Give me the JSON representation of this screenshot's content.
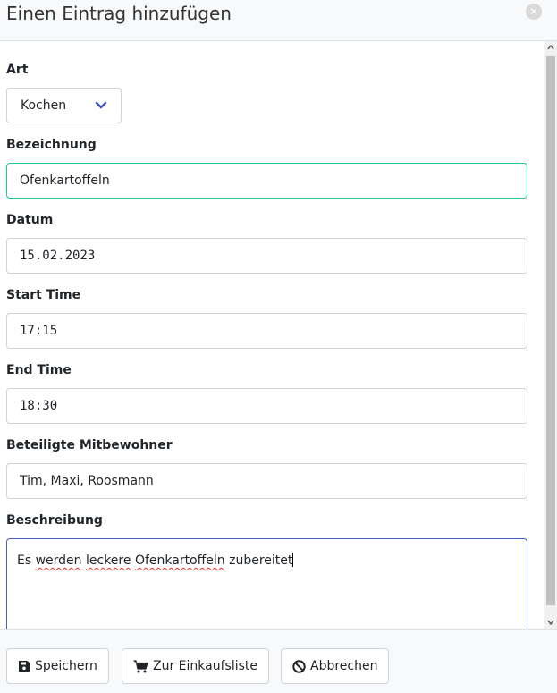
{
  "dialog": {
    "title": "Einen Eintrag hinzufügen",
    "close_icon": "close-icon"
  },
  "form": {
    "art": {
      "label": "Art",
      "selected": "Kochen"
    },
    "bezeichnung": {
      "label": "Bezeichnung",
      "value": "Ofenkartoffeln"
    },
    "datum": {
      "label": "Datum",
      "value": "15.02.2023"
    },
    "start_time": {
      "label": "Start Time",
      "value": "17:15"
    },
    "end_time": {
      "label": "End Time",
      "value": "18:30"
    },
    "mitbewohner": {
      "label": "Beteiligte Mitbewohner",
      "value": "Tim, Maxi, Roosmann"
    },
    "beschreibung": {
      "label": "Beschreibung",
      "words": [
        "Es",
        "werden",
        "leckere",
        "Ofenkartoffeln",
        "zubereitet"
      ]
    }
  },
  "footer": {
    "save_label": "Speichern",
    "shopping_label": "Zur Einkaufsliste",
    "cancel_label": "Abbrechen"
  },
  "colors": {
    "focus_border": "#20c997",
    "textarea_border": "#4a5dc9",
    "chevron": "#3f51b5"
  }
}
